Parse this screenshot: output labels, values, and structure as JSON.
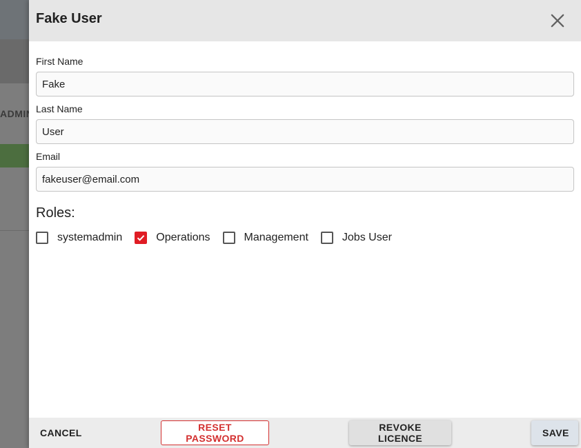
{
  "background": {
    "partial_label": "ADMIN"
  },
  "dialog": {
    "title": "Fake User",
    "close_icon": "close-icon",
    "fields": {
      "first_name": {
        "label": "First Name",
        "value": "Fake"
      },
      "last_name": {
        "label": "Last Name",
        "value": "User"
      },
      "email": {
        "label": "Email",
        "value": "fakeuser@email.com"
      }
    },
    "roles": {
      "title": "Roles:",
      "items": [
        {
          "label": "systemadmin",
          "checked": false
        },
        {
          "label": "Operations",
          "checked": true
        },
        {
          "label": "Management",
          "checked": false
        },
        {
          "label": "Jobs User",
          "checked": false
        }
      ]
    },
    "footer": {
      "cancel_label": "CANCEL",
      "reset_password_label": "RESET PASSWORD",
      "revoke_licence_label": "REVOKE LICENCE",
      "save_label": "SAVE"
    }
  },
  "colors": {
    "accent_red": "#e01c24",
    "header_bg": "#e6e6e6"
  }
}
